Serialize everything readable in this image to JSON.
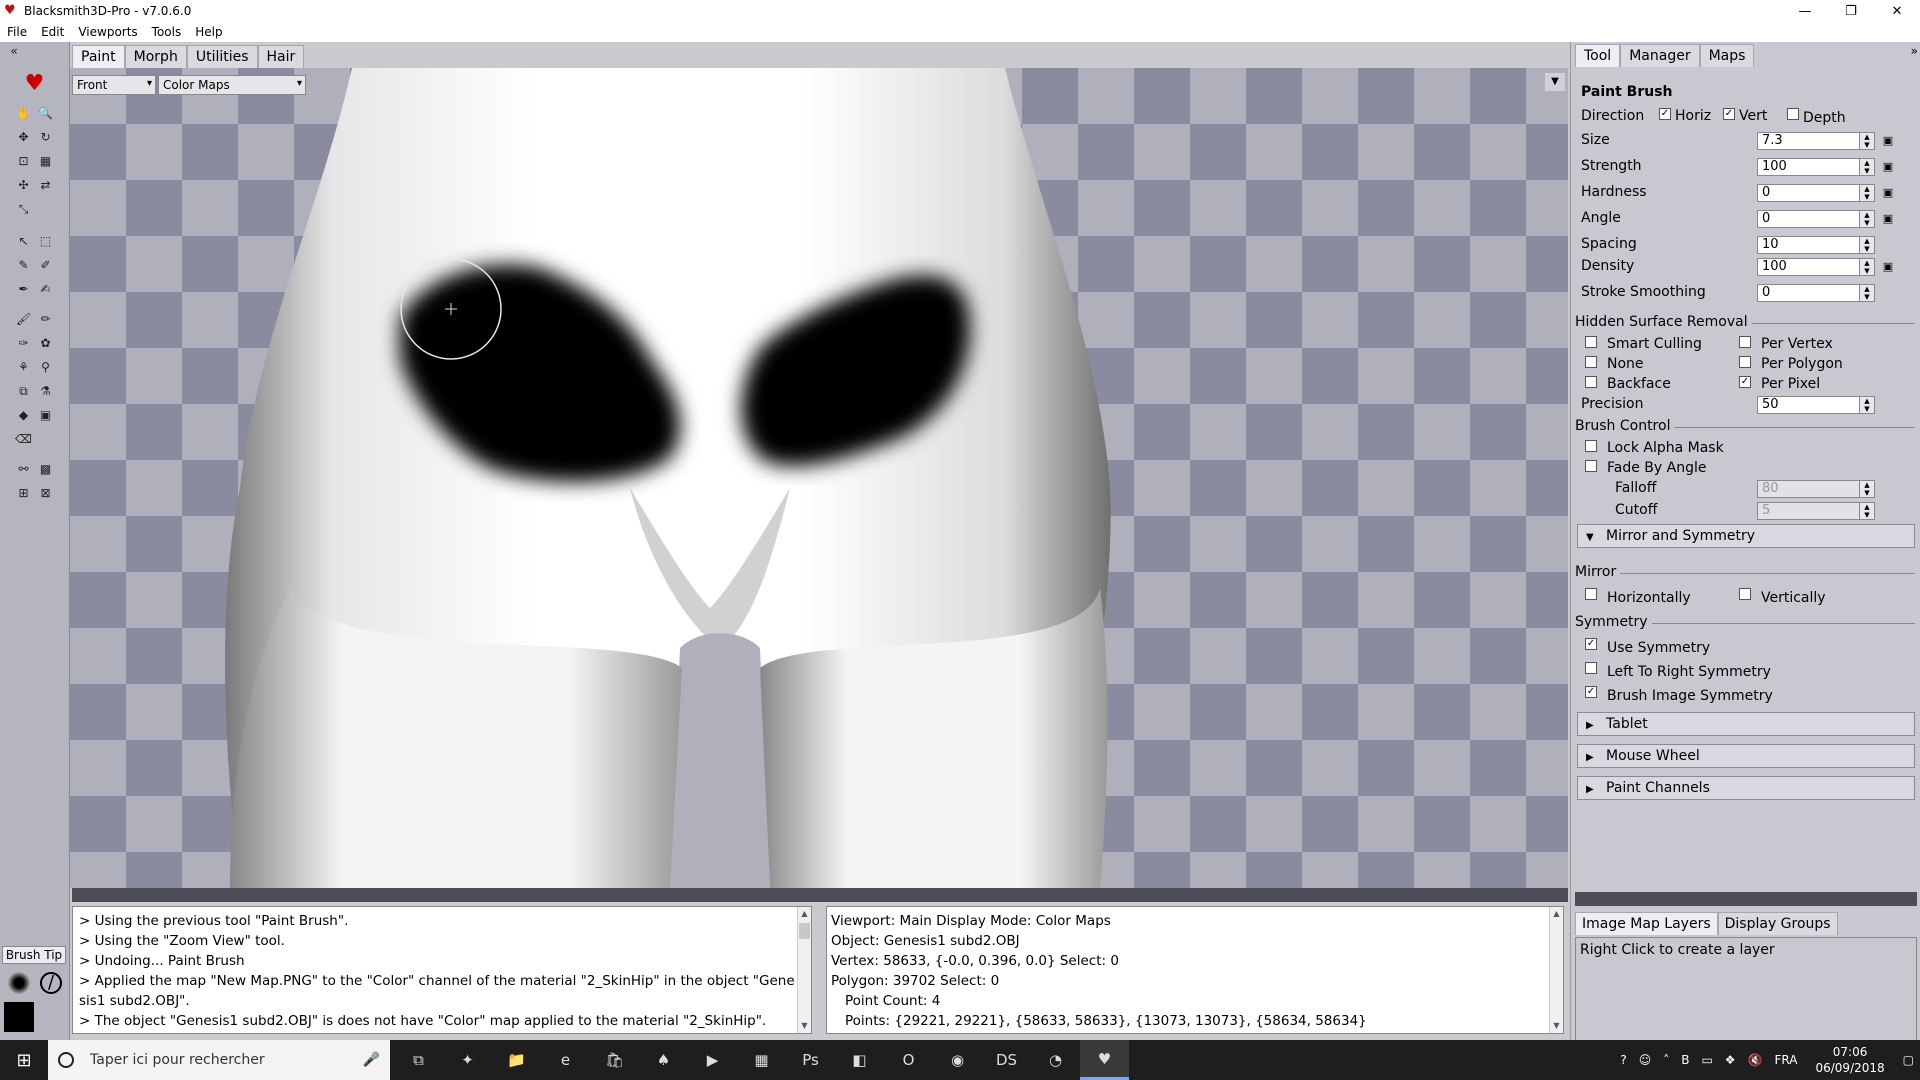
{
  "window": {
    "title": "Blacksmith3D-Pro - v7.0.6.0",
    "controls": {
      "minimize": "—",
      "restore": "❐",
      "close": "✕"
    }
  },
  "menu": [
    "File",
    "Edit",
    "Viewports",
    "Tools",
    "Help"
  ],
  "mode_tabs": [
    "Paint",
    "Morph",
    "Utilities",
    "Hair"
  ],
  "viewport": {
    "view_select": "Front",
    "display_select": "Color Maps"
  },
  "left_toolbar": {
    "brush_tip_label": "Brush Tip"
  },
  "log": {
    "lines": [
      "> Using the previous tool \"Paint Brush\".",
      "> Using the \"Zoom View\" tool.",
      "> Undoing... Paint Brush",
      "> Applied the map \"New Map.PNG\" to the \"Color\" channel of the material \"2_SkinHip\" in the object \"Gene",
      "sis1 subd2.OBJ\".",
      "> The object \"Genesis1 subd2.OBJ\" is does not have \"Color\" map applied to the material \"2_SkinHip\"."
    ]
  },
  "info": {
    "viewport_line": "Viewport: Main Display Mode: Color Maps",
    "object_line": "Object: Genesis1 subd2.OBJ",
    "vertex_line": "Vertex: 58633, {-0.0, 0.396, 0.0}     Select: 0",
    "polygon_line": "Polygon: 39702    Select: 0",
    "point_count_line": "Point Count: 4",
    "points_line": "Points:  {29221, 29221},  {58633, 58633},  {13073, 13073},  {58634, 58634}"
  },
  "right_tabs": [
    "Tool",
    "Manager",
    "Maps"
  ],
  "paint_brush": {
    "title": "Paint Brush",
    "direction_label": "Direction",
    "horiz": "Horiz",
    "vert": "Vert",
    "depth": "Depth",
    "fields": [
      {
        "label": "Size",
        "value": "7.3"
      },
      {
        "label": "Strength",
        "value": "100"
      },
      {
        "label": "Hardness",
        "value": "0"
      },
      {
        "label": "Angle",
        "value": "0"
      },
      {
        "label": "Spacing",
        "value": "10"
      },
      {
        "label": "Density",
        "value": "100"
      },
      {
        "label": "Stroke Smoothing",
        "value": "0"
      }
    ]
  },
  "hidden_surface": {
    "title": "Hidden Surface Removal",
    "smart_culling": "Smart Culling",
    "none": "None",
    "backface": "Backface",
    "per_vertex": "Per Vertex",
    "per_polygon": "Per Polygon",
    "per_pixel": "Per Pixel",
    "precision_label": "Precision",
    "precision_value": "50"
  },
  "brush_control": {
    "title": "Brush Control",
    "lock_alpha": "Lock Alpha Mask",
    "fade_by_angle": "Fade By Angle",
    "falloff_label": "Falloff",
    "falloff_value": "80",
    "cutoff_label": "Cutoff",
    "cutoff_value": "5"
  },
  "mirror_symmetry": {
    "header": "Mirror and Symmetry",
    "mirror_title": "Mirror",
    "horizontally": "Horizontally",
    "vertically": "Vertically",
    "symmetry_title": "Symmetry",
    "use_symmetry": "Use Symmetry",
    "left_to_right": "Left To Right Symmetry",
    "brush_image": "Brush Image Symmetry"
  },
  "accordions": [
    "Tablet",
    "Mouse Wheel",
    "Paint Channels"
  ],
  "layers": {
    "tabs": [
      "Image Map Layers",
      "Display Groups"
    ],
    "hint": "Right Click to create a layer"
  },
  "taskbar": {
    "search_placeholder": "Taper ici pour rechercher",
    "language": "FRA",
    "time": "07:06",
    "date": "06/09/2018"
  }
}
